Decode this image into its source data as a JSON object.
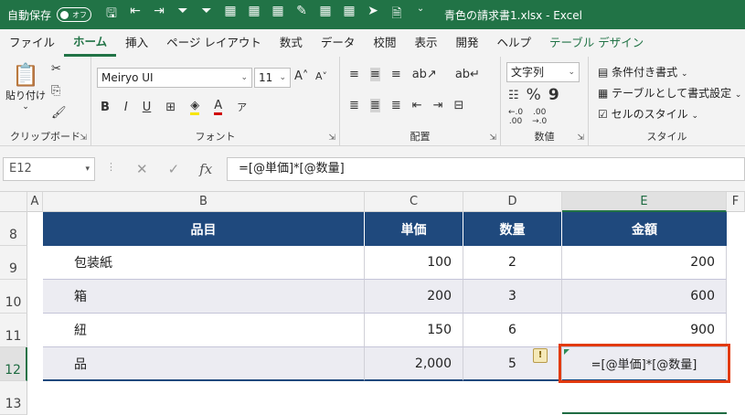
{
  "titlebar": {
    "autosave_label": "自動保存",
    "autosave_state": "オフ",
    "document_title": "青色の請求書1.xlsx  -  Excel",
    "accent_color": "#217346"
  },
  "ribbon_tabs": [
    {
      "label": "ファイル"
    },
    {
      "label": "ホーム"
    },
    {
      "label": "挿入"
    },
    {
      "label": "ページ レイアウト"
    },
    {
      "label": "数式"
    },
    {
      "label": "データ"
    },
    {
      "label": "校閲"
    },
    {
      "label": "表示"
    },
    {
      "label": "開発"
    },
    {
      "label": "ヘルプ"
    },
    {
      "label": "テーブル デザイン"
    }
  ],
  "ribbon": {
    "clipboard": {
      "paste_label": "貼り付け",
      "group_label": "クリップボード"
    },
    "font": {
      "font_name": "Meiryo UI",
      "font_size": "11",
      "group_label": "フォント"
    },
    "alignment": {
      "group_label": "配置"
    },
    "number": {
      "format": "文字列",
      "percent": "%",
      "comma": "9",
      "group_label": "数値"
    },
    "styles": {
      "conditional": "条件付き書式",
      "as_table": "テーブルとして書式設定",
      "cell_styles": "セルのスタイル",
      "group_label": "スタイル"
    }
  },
  "formula_bar": {
    "name_box": "E12",
    "fx": "fx",
    "formula": "=[@単価]*[@数量]"
  },
  "sheet": {
    "columns": [
      "A",
      "B",
      "C",
      "D",
      "E",
      "F"
    ],
    "rows": [
      "8",
      "9",
      "10",
      "11",
      "12",
      "13"
    ],
    "header": [
      "品目",
      "単価",
      "数量",
      "金額"
    ],
    "data": [
      [
        "包装紙",
        "100",
        "2",
        "200"
      ],
      [
        "箱",
        "200",
        "3",
        "600"
      ],
      [
        "紐",
        "150",
        "6",
        "900"
      ],
      [
        "品",
        "2,000",
        "5",
        "=[@単価]*[@数量]"
      ]
    ],
    "warning_glyph": "!",
    "table_header_color": "#1f497d",
    "highlight_color": "#e23a0f"
  }
}
